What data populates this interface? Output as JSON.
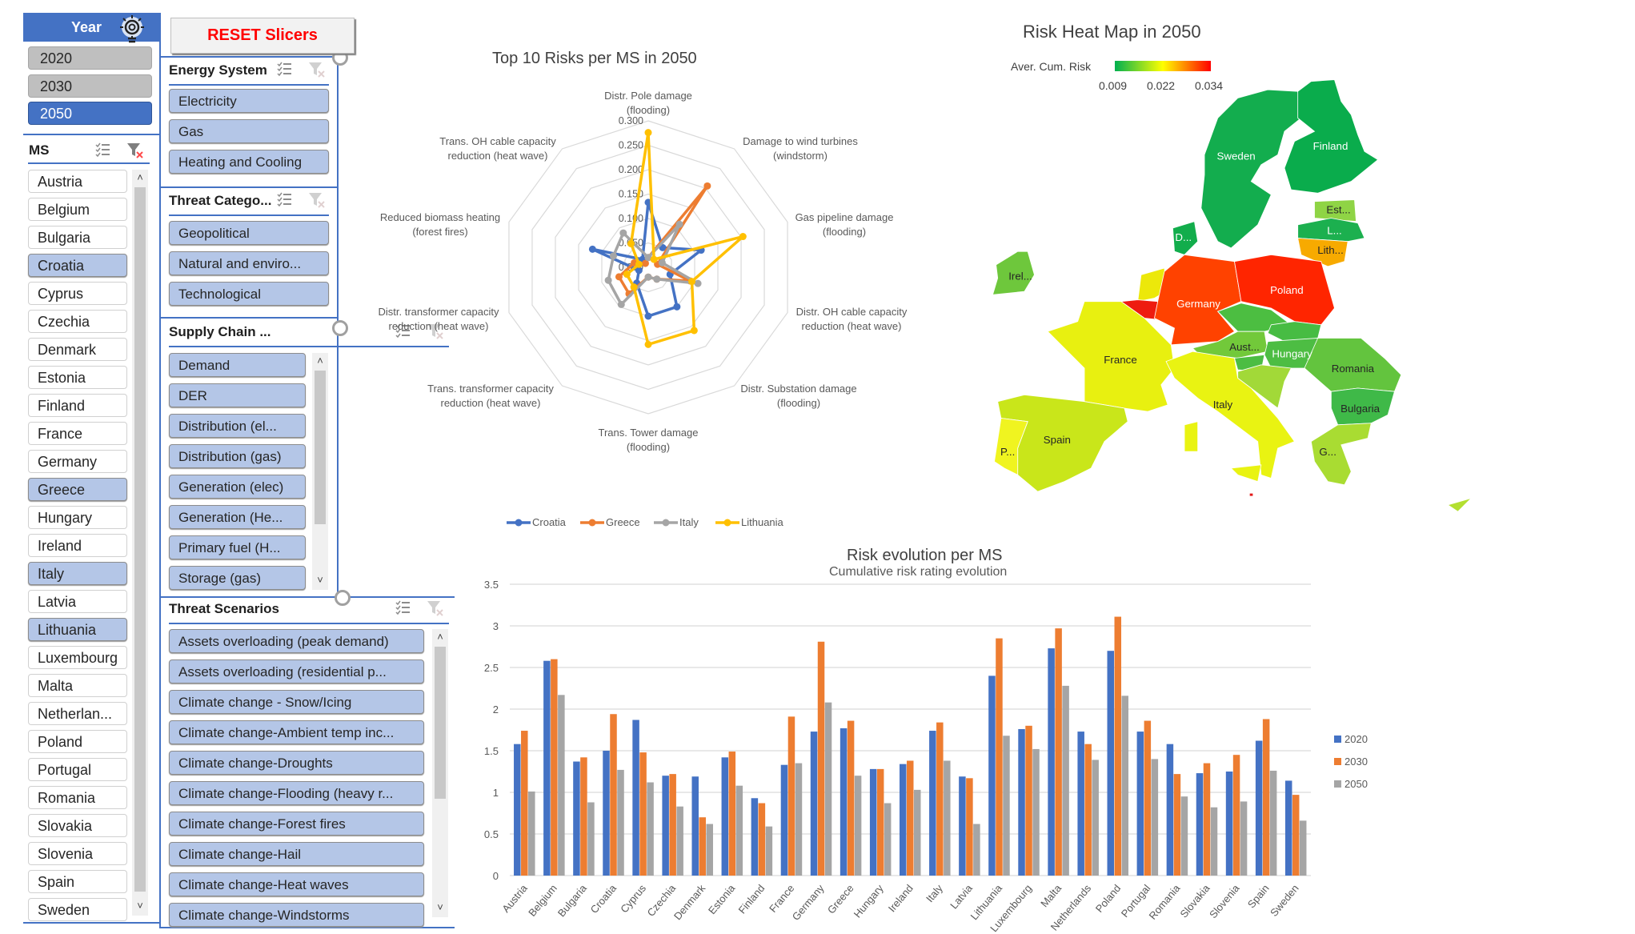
{
  "reset_button": "RESET Slicers",
  "year_slicer": {
    "title": "Year",
    "items": [
      {
        "label": "2020",
        "selected": false
      },
      {
        "label": "2030",
        "selected": false
      },
      {
        "label": "2050",
        "selected": true
      }
    ]
  },
  "ms_slicer": {
    "title": "MS",
    "items": [
      {
        "label": "Austria",
        "selected": false
      },
      {
        "label": "Belgium",
        "selected": false
      },
      {
        "label": "Bulgaria",
        "selected": false
      },
      {
        "label": "Croatia",
        "selected": true
      },
      {
        "label": "Cyprus",
        "selected": false
      },
      {
        "label": "Czechia",
        "selected": false
      },
      {
        "label": "Denmark",
        "selected": false
      },
      {
        "label": "Estonia",
        "selected": false
      },
      {
        "label": "Finland",
        "selected": false
      },
      {
        "label": "France",
        "selected": false
      },
      {
        "label": "Germany",
        "selected": false
      },
      {
        "label": "Greece",
        "selected": true
      },
      {
        "label": "Hungary",
        "selected": false
      },
      {
        "label": "Ireland",
        "selected": false
      },
      {
        "label": "Italy",
        "selected": true
      },
      {
        "label": "Latvia",
        "selected": false
      },
      {
        "label": "Lithuania",
        "selected": true
      },
      {
        "label": "Luxembourg",
        "selected": false
      },
      {
        "label": "Malta",
        "selected": false
      },
      {
        "label": "Netherlan...",
        "selected": false
      },
      {
        "label": "Poland",
        "selected": false
      },
      {
        "label": "Portugal",
        "selected": false
      },
      {
        "label": "Romania",
        "selected": false
      },
      {
        "label": "Slovakia",
        "selected": false
      },
      {
        "label": "Slovenia",
        "selected": false
      },
      {
        "label": "Spain",
        "selected": false
      },
      {
        "label": "Sweden",
        "selected": false
      }
    ]
  },
  "energy_slicer": {
    "title": "Energy System",
    "items": [
      "Electricity",
      "Gas",
      "Heating and Cooling"
    ]
  },
  "threat_category_slicer": {
    "title": "Threat Catego...",
    "items": [
      "Geopolitical",
      "Natural and enviro...",
      "Technological"
    ]
  },
  "supply_chain_slicer": {
    "title": "Supply Chain ...",
    "items": [
      "Demand",
      "DER",
      "Distribution (el...",
      "Distribution (gas)",
      "Generation (elec)",
      "Generation (He...",
      "Primary fuel (H...",
      "Storage (gas)"
    ]
  },
  "threat_scenarios_slicer": {
    "title": "Threat Scenarios",
    "items": [
      "Assets overloading (peak demand)",
      "Assets overloading (residential p...",
      "Climate change - Snow/Icing",
      "Climate change-Ambient temp inc...",
      "Climate change-Droughts",
      "Climate change-Flooding (heavy r...",
      "Climate change-Forest fires",
      "Climate change-Hail",
      "Climate change-Heat waves",
      "Climate change-Windstorms"
    ]
  },
  "icons": {
    "multi_select": "multi-select-icon",
    "clear_filter": "clear-filter-icon",
    "year_header": "lightbulb-gear-icon",
    "scroll_up": "chevron-up-icon",
    "scroll_down": "chevron-down-icon"
  },
  "heatmap": {
    "title": "Risk Heat Map in  2050",
    "legend_title": "Aver. Cum. Risk",
    "legend_ticks": [
      "0.009",
      "0.022",
      "0.034"
    ],
    "legend_colors": [
      "#00b050",
      "#ffff00",
      "#ff0000"
    ],
    "countries": [
      {
        "id": "sweden",
        "label": "Sweden",
        "color": "#13ad4e",
        "label_color": "#ffffff"
      },
      {
        "id": "finland",
        "label": "Finland",
        "color": "#0aac4c",
        "label_color": "#ffffff"
      },
      {
        "id": "estonia",
        "label": "Est...",
        "color": "#8fd445",
        "label_color": "#262626"
      },
      {
        "id": "latvia",
        "label": "L...",
        "color": "#1cb04f",
        "label_color": "#ffffff"
      },
      {
        "id": "lithuania",
        "label": "Lith...",
        "color": "#f7aa00",
        "label_color": "#262626"
      },
      {
        "id": "denmark",
        "label": "D...",
        "color": "#12ad4c",
        "label_color": "#ffffff"
      },
      {
        "id": "ireland",
        "label": "Irel...",
        "color": "#6ec73c",
        "label_color": "#262626"
      },
      {
        "id": "netherlands",
        "label": "",
        "color": "#ece80a",
        "label_color": "#262626"
      },
      {
        "id": "belgium",
        "label": "",
        "color": "#ee1c10",
        "label_color": "#262626"
      },
      {
        "id": "germany",
        "label": "Germany",
        "color": "#ff4200",
        "label_color": "#ffffff"
      },
      {
        "id": "poland",
        "label": "Poland",
        "color": "#ff2500",
        "label_color": "#ffffff"
      },
      {
        "id": "czechia",
        "label": "",
        "color": "#4cbe41",
        "label_color": "#262626"
      },
      {
        "id": "slovakia",
        "label": "",
        "color": "#47bc43",
        "label_color": "#262626"
      },
      {
        "id": "austria",
        "label": "Aust...",
        "color": "#72c93a",
        "label_color": "#262626"
      },
      {
        "id": "hungary",
        "label": "Hungary",
        "color": "#4dbd43",
        "label_color": "#ffffff"
      },
      {
        "id": "slovenia",
        "label": "",
        "color": "#4cbd43",
        "label_color": "#262626"
      },
      {
        "id": "croatia",
        "label": "",
        "color": "#a2d938",
        "label_color": "#262626"
      },
      {
        "id": "romania",
        "label": "Romania",
        "color": "#63c43e",
        "label_color": "#262626"
      },
      {
        "id": "bulgaria",
        "label": "Bulgaria",
        "color": "#3fb948",
        "label_color": "#262626"
      },
      {
        "id": "greece",
        "label": "G...",
        "color": "#a9dc32",
        "label_color": "#262626"
      },
      {
        "id": "france",
        "label": "France",
        "color": "#e8f010",
        "label_color": "#262626"
      },
      {
        "id": "italy",
        "label": "Italy",
        "color": "#e9f312",
        "label_color": "#262626"
      },
      {
        "id": "spain",
        "label": "Spain",
        "color": "#c9e61a",
        "label_color": "#262626"
      },
      {
        "id": "portugal",
        "label": "P...",
        "color": "#f0f420",
        "label_color": "#262626"
      },
      {
        "id": "cyprus",
        "label": "",
        "color": "#b3df30",
        "label_color": "#262626"
      },
      {
        "id": "malta",
        "label": "",
        "color": "#e31a1a",
        "label_color": "#262626"
      }
    ]
  },
  "chart_data": [
    {
      "type": "radar",
      "title": "Top 10 Risks per MS in  2050",
      "axes": [
        [
          "Distr. Pole damage",
          "(flooding)"
        ],
        [
          "Damage to wind turbines",
          "(windstorm)"
        ],
        [
          "Gas pipeline damage",
          "(flooding)"
        ],
        [
          "Distr. OH cable capacity",
          "reduction (heat wave)"
        ],
        [
          "Distr. Substation damage",
          "(flooding)"
        ],
        [
          "Trans. Tower damage",
          "(flooding)"
        ],
        [
          "Trans. transformer capacity",
          "reduction (heat wave)"
        ],
        [
          "Distr. transformer capacity",
          "reduction (heat wave)"
        ],
        [
          "Reduced biomass heating",
          "(forest fires)"
        ],
        [
          "Trans. OH cable capacity",
          "reduction (heat wave)"
        ]
      ],
      "ticks": [
        "0.000",
        "0.050",
        "0.100",
        "0.150",
        "0.200",
        "0.250",
        "0.300"
      ],
      "range": [
        0,
        0.3
      ],
      "legend_position": "bottom",
      "series": [
        {
          "name": "Croatia",
          "color": "#4472c4",
          "values": [
            0.133,
            0.05,
            0.114,
            0.047,
            0.1,
            0.1,
            0.04,
            0.02,
            0.12,
            0.02
          ]
        },
        {
          "name": "Greece",
          "color": "#ed7d31",
          "values": [
            0.02,
            0.206,
            0.02,
            0.09,
            0.03,
            0.02,
            0.067,
            0.063,
            0.03,
            0.01
          ]
        },
        {
          "name": "Italy",
          "color": "#a5a5a5",
          "values": [
            0.02,
            0.109,
            0.03,
            0.107,
            0.03,
            0.02,
            0.094,
            0.086,
            0.075,
            0.087
          ]
        },
        {
          "name": "Lithuania",
          "color": "#ffc000",
          "values": [
            0.276,
            0.02,
            0.204,
            0.094,
            0.16,
            0.158,
            0.05,
            0.046,
            0.02,
            0.06
          ]
        }
      ]
    },
    {
      "type": "bar",
      "title": "Risk evolution per MS",
      "subtitle": "Cumulative risk rating evolution",
      "ylim": [
        0,
        3.5
      ],
      "yticks": [
        "0",
        "0.5",
        "1",
        "1.5",
        "2",
        "2.5",
        "3",
        "3.5"
      ],
      "grid": true,
      "legend_position": "right",
      "categories": [
        "Austria",
        "Belgium",
        "Bulgaria",
        "Croatia",
        "Cyprus",
        "Czechia",
        "Denmark",
        "Estonia",
        "Finland",
        "France",
        "Germany",
        "Greece",
        "Hungary",
        "Ireland",
        "Italy",
        "Latvia",
        "Lithuania",
        "Luxembourg",
        "Malta",
        "Netherlands",
        "Poland",
        "Portugal",
        "Romania",
        "Slovakia",
        "Slovenia",
        "Spain",
        "Sweden"
      ],
      "series": [
        {
          "name": "2020",
          "color": "#4472c4",
          "values": [
            1.58,
            2.58,
            1.37,
            1.5,
            1.87,
            1.2,
            1.19,
            1.42,
            0.93,
            1.33,
            1.73,
            1.77,
            1.28,
            1.34,
            1.74,
            1.19,
            2.4,
            1.76,
            2.73,
            1.73,
            2.7,
            1.73,
            1.58,
            1.23,
            1.25,
            1.62,
            1.14
          ]
        },
        {
          "name": "2030",
          "color": "#ed7d31",
          "values": [
            1.74,
            2.6,
            1.42,
            1.94,
            1.48,
            1.22,
            0.7,
            1.49,
            0.87,
            1.91,
            2.81,
            1.86,
            1.28,
            1.38,
            1.84,
            1.17,
            2.85,
            1.8,
            2.97,
            1.58,
            3.11,
            1.86,
            1.22,
            1.35,
            1.45,
            1.88,
            0.97
          ]
        },
        {
          "name": "2050",
          "color": "#a5a5a5",
          "values": [
            1.01,
            2.17,
            0.88,
            1.27,
            1.12,
            0.83,
            0.62,
            1.08,
            0.59,
            1.35,
            2.08,
            1.2,
            0.87,
            1.03,
            1.38,
            0.62,
            1.68,
            1.52,
            2.28,
            1.39,
            2.16,
            1.4,
            0.95,
            0.82,
            0.89,
            1.26,
            0.66
          ]
        }
      ]
    }
  ]
}
